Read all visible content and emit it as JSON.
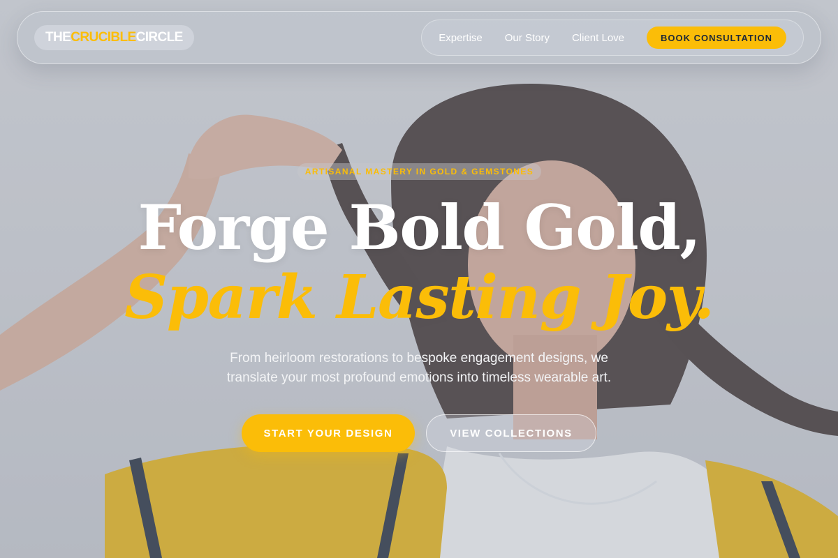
{
  "brand": {
    "logo_part1": "THE ",
    "logo_accent": "CRUCIBLE",
    "logo_part2": " CIRCLE",
    "accent_color": "#fbbd08"
  },
  "nav": {
    "links": [
      "Expertise",
      "Our Story",
      "Client Love"
    ],
    "cta_label": "BOOK CONSULTATION"
  },
  "hero": {
    "eyebrow": "ARTISANAL MASTERY IN GOLD & GEMSTONES",
    "headline": "Forge Bold Gold,",
    "headline_accent": "Spark Lasting Joy.",
    "subtext_line1": "From heirloom restorations to bespoke engagement designs, we",
    "subtext_line2": "translate your most profound emotions into timeless wearable art.",
    "primary_cta": "START YOUR DESIGN",
    "secondary_cta": "VIEW COLLECTIONS",
    "background_image": "woman-with-braids-yellow-jersey"
  }
}
